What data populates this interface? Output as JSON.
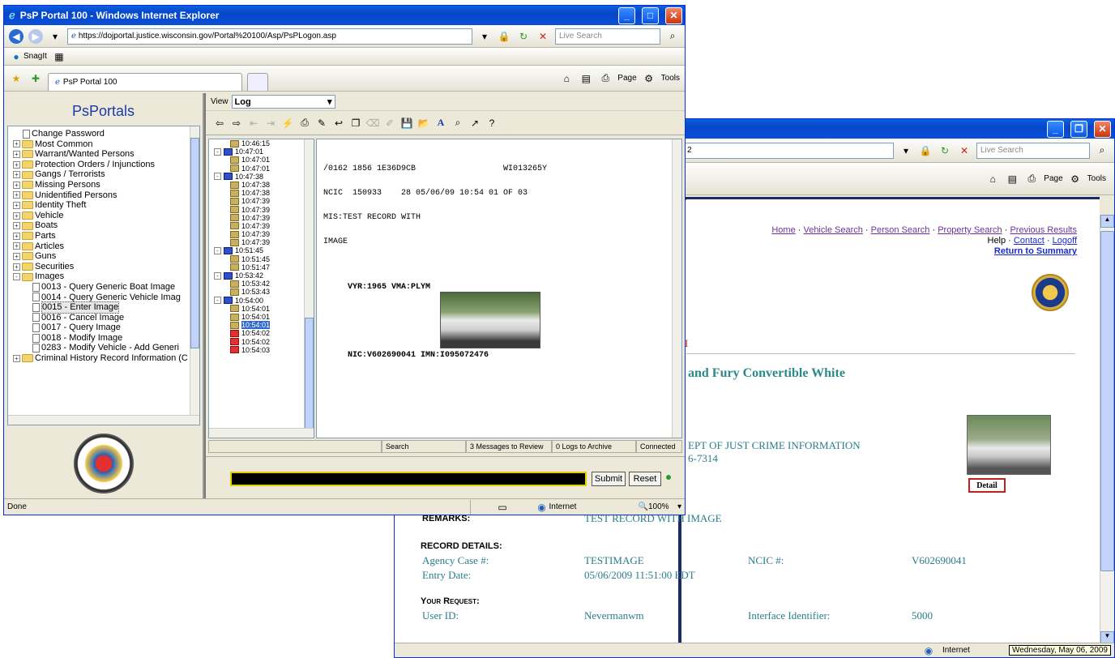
{
  "back_window": {
    "address_tail": "2",
    "search_placeholder": "Live Search",
    "nav_links": [
      "Home",
      "Vehicle Search",
      "Person Search",
      "Property Search",
      "Previous Results"
    ],
    "nav_help": "Help",
    "nav_contact": "Contact",
    "nav_logoff": "Logoff",
    "nav_return": "Return to Summary",
    "red_fragment": "I",
    "vehicle_heading": "and Fury Convertible White",
    "agency_line1": "EPT OF JUST CRIME INFORMATION",
    "agency_line2": "6-7314",
    "detail_button": "Detail",
    "remarks_label": "REMARKS:",
    "remarks_value": "TEST RECORD WITH IMAGE",
    "record_details_label": "RECORD DETAILS:",
    "agency_case_label": "Agency Case #:",
    "agency_case_value": "TESTIMAGE",
    "ncic_label": "NCIC #:",
    "ncic_value": "V602690041",
    "entry_date_label": "Entry Date:",
    "entry_date_value": "05/06/2009 11:51:00 EDT",
    "your_request_label": "Your Request:",
    "user_id_label": "User ID:",
    "user_id_value": "Nevermanwm",
    "interface_label": "Interface Identifier:",
    "interface_value": "5000",
    "status_zone": "Internet",
    "status_date": "Wednesday, May 06, 2009",
    "page_menu": "Page",
    "tools_menu": "Tools"
  },
  "front_window": {
    "title": "PsP Portal 100 - Windows Internet Explorer",
    "address": "https://dojportal.justice.wisconsin.gov/Portal%20100/Asp/PsPLogon.asp",
    "search_placeholder": "Live Search",
    "links_snagit": "SnagIt",
    "tab_title": "PsP Portal 100",
    "page_menu": "Page",
    "tools_menu": "Tools",
    "portal_title": "PsPortals",
    "tree": [
      {
        "type": "doc",
        "label": "Change Password",
        "indent": 1
      },
      {
        "type": "folder",
        "label": "Most Common",
        "indent": 0,
        "pm": "+"
      },
      {
        "type": "folder",
        "label": "Warrant/Wanted Persons",
        "indent": 0,
        "pm": "+"
      },
      {
        "type": "folder",
        "label": "Protection Orders / Injunctions",
        "indent": 0,
        "pm": "+"
      },
      {
        "type": "folder",
        "label": "Gangs / Terrorists",
        "indent": 0,
        "pm": "+"
      },
      {
        "type": "folder",
        "label": "Missing Persons",
        "indent": 0,
        "pm": "+"
      },
      {
        "type": "folder",
        "label": "Unidentified Persons",
        "indent": 0,
        "pm": "+"
      },
      {
        "type": "folder",
        "label": "Identity Theft",
        "indent": 0,
        "pm": "+"
      },
      {
        "type": "folder",
        "label": "Vehicle",
        "indent": 0,
        "pm": "+"
      },
      {
        "type": "folder",
        "label": "Boats",
        "indent": 0,
        "pm": "+"
      },
      {
        "type": "folder",
        "label": "Parts",
        "indent": 0,
        "pm": "+"
      },
      {
        "type": "folder",
        "label": "Articles",
        "indent": 0,
        "pm": "+"
      },
      {
        "type": "folder",
        "label": "Guns",
        "indent": 0,
        "pm": "+"
      },
      {
        "type": "folder",
        "label": "Securities",
        "indent": 0,
        "pm": "+"
      },
      {
        "type": "folder",
        "label": "Images",
        "indent": 0,
        "pm": "-"
      },
      {
        "type": "doc",
        "label": "0013 - Query Generic Boat Image",
        "indent": 2
      },
      {
        "type": "doc",
        "label": "0014 - Query Generic Vehicle Imag",
        "indent": 2
      },
      {
        "type": "doc",
        "label": "0015 - Enter Image",
        "indent": 2,
        "selected": true
      },
      {
        "type": "doc",
        "label": "0016 - Cancel Image",
        "indent": 2
      },
      {
        "type": "doc",
        "label": "0017 - Query  Image",
        "indent": 2
      },
      {
        "type": "doc",
        "label": "0018 - Modify Image",
        "indent": 2
      },
      {
        "type": "doc",
        "label": "0283 - Modify Vehicle - Add Generi",
        "indent": 2
      },
      {
        "type": "folder",
        "label": "Criminal History Record Information (C",
        "indent": 0,
        "pm": "+"
      }
    ],
    "view_label": "View",
    "view_value": "Log",
    "log_entries": [
      {
        "t": "10:46:15",
        "kind": "msg",
        "level": 2
      },
      {
        "t": "10:47:01",
        "kind": "blue",
        "level": 1
      },
      {
        "t": "10:47:01",
        "kind": "msg",
        "level": 2
      },
      {
        "t": "10:47:01",
        "kind": "msg",
        "level": 2
      },
      {
        "t": "10:47:38",
        "kind": "blue",
        "level": 1
      },
      {
        "t": "10:47:38",
        "kind": "msg",
        "level": 2
      },
      {
        "t": "10:47:38",
        "kind": "msg",
        "level": 2
      },
      {
        "t": "10:47:39",
        "kind": "msg",
        "level": 2
      },
      {
        "t": "10:47:39",
        "kind": "msg",
        "level": 2
      },
      {
        "t": "10:47:39",
        "kind": "msg",
        "level": 2
      },
      {
        "t": "10:47:39",
        "kind": "msg",
        "level": 2
      },
      {
        "t": "10:47:39",
        "kind": "msg",
        "level": 2
      },
      {
        "t": "10:47:39",
        "kind": "msg",
        "level": 2
      },
      {
        "t": "10:51:45",
        "kind": "blue",
        "level": 1
      },
      {
        "t": "10:51:45",
        "kind": "msg",
        "level": 2
      },
      {
        "t": "10:51:47",
        "kind": "msg",
        "level": 2
      },
      {
        "t": "10:53:42",
        "kind": "blue",
        "level": 1
      },
      {
        "t": "10:53:42",
        "kind": "msg",
        "level": 2
      },
      {
        "t": "10:53:43",
        "kind": "msg",
        "level": 2
      },
      {
        "t": "10:54:00",
        "kind": "blue",
        "level": 1
      },
      {
        "t": "10:54:01",
        "kind": "msg",
        "level": 2
      },
      {
        "t": "10:54:01",
        "kind": "msg",
        "level": 2
      },
      {
        "t": "10:54:01",
        "kind": "msg",
        "level": 2,
        "selected": true
      },
      {
        "t": "10:54:02",
        "kind": "red",
        "level": 2
      },
      {
        "t": "10:54:02",
        "kind": "red",
        "level": 2
      },
      {
        "t": "10:54:03",
        "kind": "red",
        "level": 2
      }
    ],
    "message_lines": [
      "/0162 1856 1E36D9CB                  WI013265Y",
      "NCIC  150933    28 05/06/09 10:54 01 OF 03",
      "MIS:TEST RECORD WITH",
      "IMAGE"
    ],
    "vyr_line": "VYR:1965 VMA:PLYM",
    "nic_line": "NIC:V602690041 IMN:I095072476",
    "status_search": "Search",
    "status_messages": "3 Messages to Review",
    "status_logs": "0 Logs to Archive",
    "status_connected": "Connected",
    "submit_label": "Submit",
    "reset_label": "Reset",
    "ie_status_done": "Done",
    "ie_status_zone": "Internet",
    "ie_status_zoom": "100%"
  }
}
